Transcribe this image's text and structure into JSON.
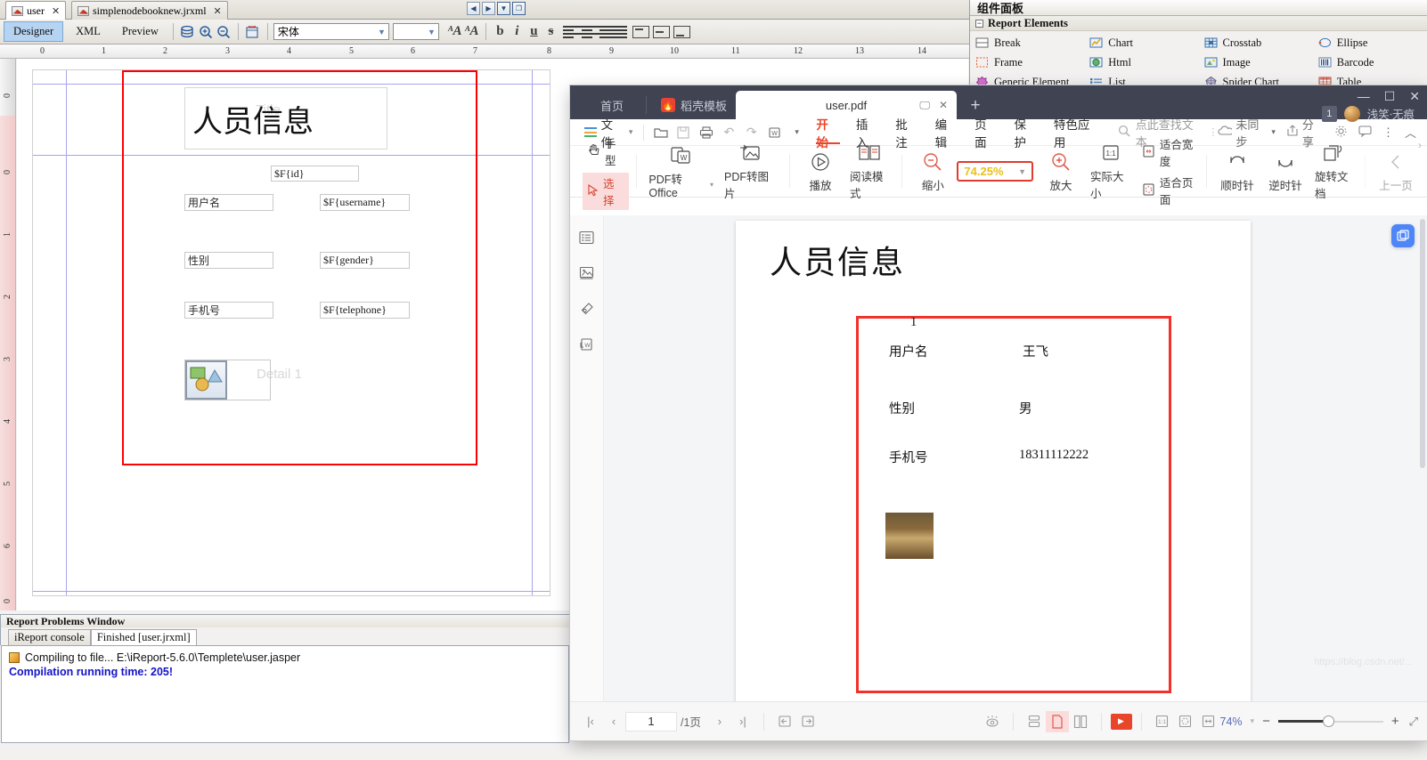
{
  "ireport": {
    "tabs": [
      {
        "label": "user",
        "active": true
      },
      {
        "label": "simplenodebooknew.jrxml",
        "active": false
      }
    ],
    "view_modes": [
      {
        "label": "Designer",
        "selected": true
      },
      {
        "label": "XML",
        "selected": false
      },
      {
        "label": "Preview",
        "selected": false
      }
    ],
    "font_family_value": "宋体",
    "font_size_value": "",
    "format_buttons": [
      "b",
      "i",
      "u",
      "s"
    ],
    "ruler": {
      "h_ticks": [
        "0",
        "1",
        "2",
        "3",
        "4",
        "5",
        "6",
        "7",
        "8",
        "9",
        "10",
        "11",
        "12",
        "13",
        "14"
      ],
      "v_ticks": [
        "0",
        "0",
        "1",
        "2",
        "3",
        "4",
        "5",
        "6",
        "0"
      ]
    },
    "report": {
      "title_text": "人员信息",
      "title_watermark": "Title",
      "detail_watermark": "Detail 1",
      "fields": [
        {
          "name": "id-field",
          "value": "$F{id}"
        },
        {
          "name": "username-label",
          "value": "用户名"
        },
        {
          "name": "username-field",
          "value": "$F{username}"
        },
        {
          "name": "gender-label",
          "value": "性别"
        },
        {
          "name": "gender-field",
          "value": "$F{gender}"
        },
        {
          "name": "telephone-label",
          "value": "手机号"
        },
        {
          "name": "telephone-field",
          "value": "$F{telephone}"
        }
      ]
    },
    "problems": {
      "window_title": "Report Problems Window",
      "tabs": [
        {
          "label": "iReport console",
          "active": false
        },
        {
          "label": "Finished [user.jrxml]",
          "active": true
        }
      ],
      "log_line_1": "Compiling to file... E:\\iReport-5.6.0\\Templete\\user.jasper",
      "log_line_2": "Compilation running time: 205!"
    }
  },
  "palette": {
    "title": "组件面板",
    "group_label": "Report Elements",
    "items": [
      {
        "label": "Break",
        "icon": "break-icon"
      },
      {
        "label": "Chart",
        "icon": "chart-icon"
      },
      {
        "label": "Crosstab",
        "icon": "crosstab-icon"
      },
      {
        "label": "Ellipse",
        "icon": "ellipse-icon"
      },
      {
        "label": "Frame",
        "icon": "frame-icon"
      },
      {
        "label": "Html",
        "icon": "html-icon"
      },
      {
        "label": "Image",
        "icon": "image-icon"
      },
      {
        "label": "Barcode",
        "icon": "barcode-icon"
      },
      {
        "label": "Generic Element",
        "icon": "generic-element-icon"
      },
      {
        "label": "List",
        "icon": "list-icon"
      },
      {
        "label": "Spider Chart",
        "icon": "spider-chart-icon"
      },
      {
        "label": "Table",
        "icon": "table-icon"
      }
    ]
  },
  "wps": {
    "tabs": {
      "home": "首页",
      "template": "稻壳模板",
      "file": "user.pdf"
    },
    "account": {
      "badge": "1",
      "name": "浅笑ᐧ无痕"
    },
    "menu": {
      "file": "文件",
      "items": [
        {
          "label": "开始",
          "active": true
        },
        {
          "label": "插入",
          "active": false
        },
        {
          "label": "批注",
          "active": false
        },
        {
          "label": "编辑",
          "active": false
        },
        {
          "label": "页面",
          "active": false
        },
        {
          "label": "保护",
          "active": false
        },
        {
          "label": "特色应用",
          "active": false
        }
      ],
      "search_placeholder": "点此查找文本",
      "sync_label": "未同步",
      "share_label": "分享"
    },
    "ribbon": {
      "hand_label": "手型",
      "select_label": "选择",
      "pdf_to_office": "PDF转Office",
      "pdf_to_image": "PDF转图片",
      "play": "播放",
      "read_mode": "阅读模式",
      "zoom_out": "缩小",
      "zoom_value": "74.25%",
      "zoom_in": "放大",
      "actual_size": "实际大小",
      "fit_width": "适合宽度",
      "fit_page": "适合页面",
      "rotate_cw": "顺时针",
      "rotate_ccw": "逆时针",
      "rotate_doc": "旋转文档",
      "prev_page": "上一页"
    },
    "document": {
      "title": "人员信息",
      "id_value": "1",
      "rows": [
        {
          "label": "用户名",
          "value": "王飞"
        },
        {
          "label": "性别",
          "value": "男"
        },
        {
          "label": "手机号",
          "value": "18311112222"
        }
      ]
    },
    "status": {
      "page_current": "1",
      "page_total": "/1页",
      "zoom_percent": "74%"
    },
    "watermark": "https://blog.csdn.net/..."
  }
}
